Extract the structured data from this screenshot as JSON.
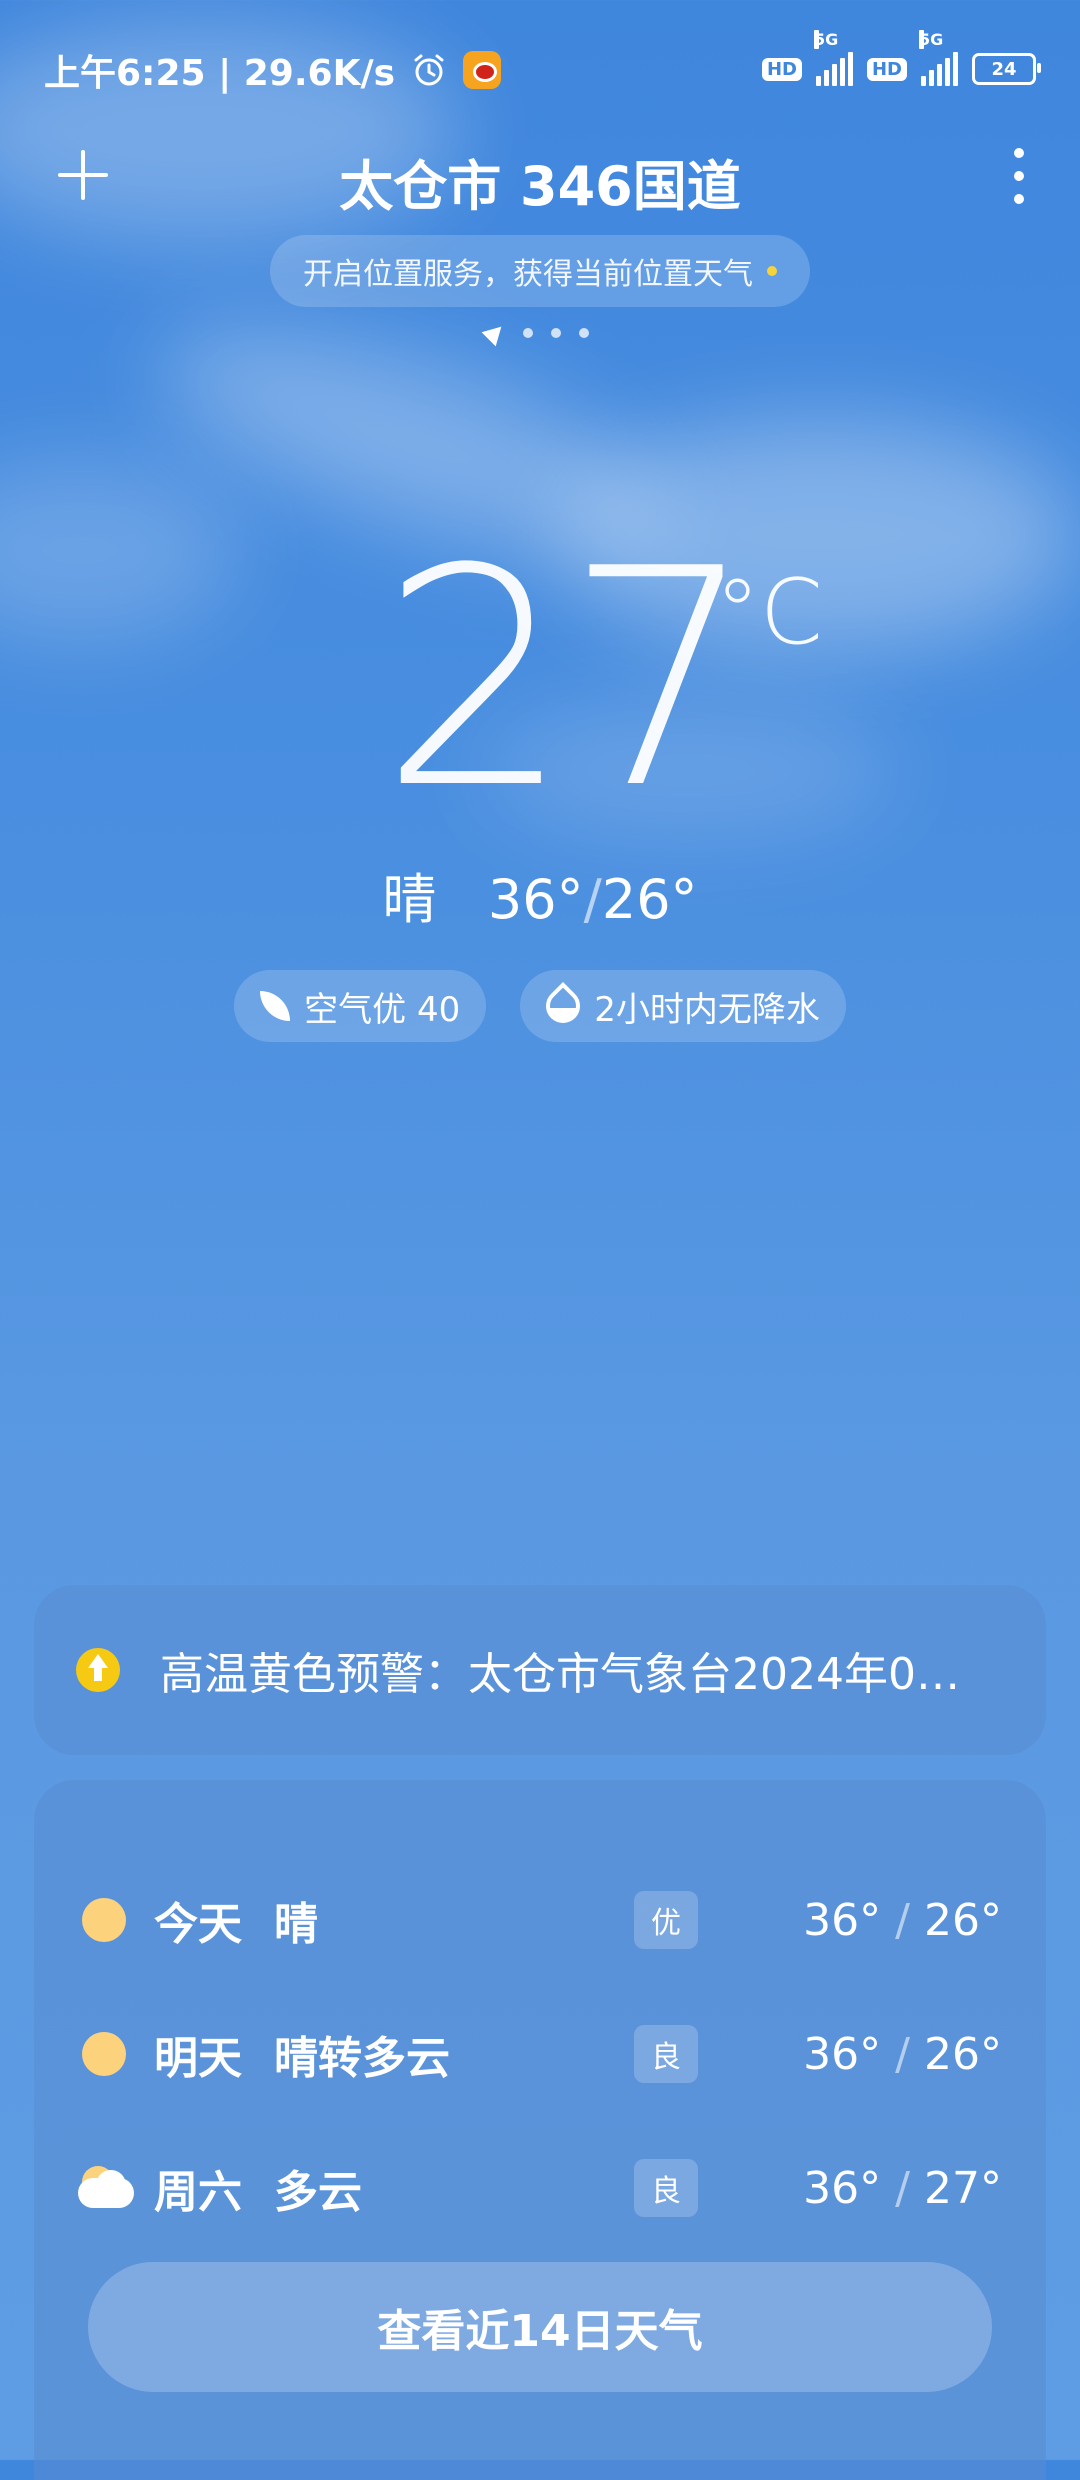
{
  "status_bar": {
    "time_speed": "上午6:25 | 29.6K/s",
    "hd1": "HD",
    "net1": "5G",
    "hd2": "HD",
    "net2": "5G",
    "battery": "24"
  },
  "header": {
    "title": "太仓市 346国道",
    "location_prompt": "开启位置服务，获得当前位置天气"
  },
  "current": {
    "temperature": "27",
    "unit": "°C",
    "condition": "晴",
    "high": "36°",
    "slash": "/",
    "low": "26°",
    "air_quality": "空气优 40",
    "precipitation": "2小时内无降水"
  },
  "alert": {
    "text": "高温黄色预警：太仓市气象台2024年0…"
  },
  "forecast": {
    "rows": [
      {
        "day": "今天",
        "desc": "晴",
        "aqi": "优",
        "high": "36°",
        "low": "26°",
        "icon": "sun-icon"
      },
      {
        "day": "明天",
        "desc": "晴转多云",
        "aqi": "良",
        "high": "36°",
        "low": "26°",
        "icon": "sun-icon"
      },
      {
        "day": "周六",
        "desc": "多云",
        "aqi": "良",
        "high": "36°",
        "low": "27°",
        "icon": "partly-cloudy-icon"
      }
    ],
    "slash": "/",
    "button_label": "查看近14日天气"
  }
}
